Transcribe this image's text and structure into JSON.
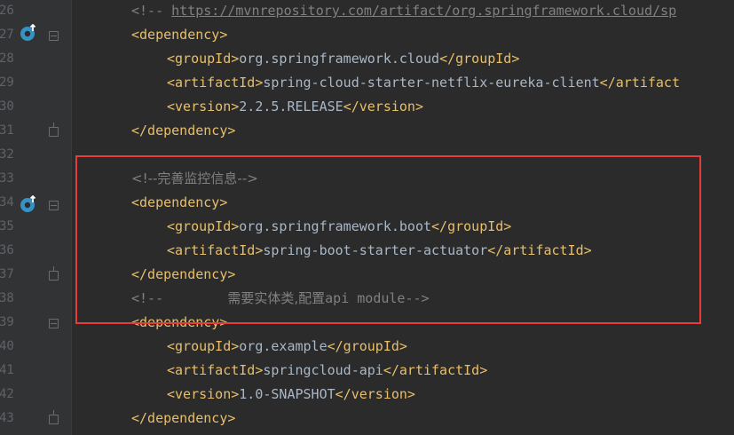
{
  "editor": {
    "line_numbers": [
      "26",
      "27",
      "28",
      "29",
      "30",
      "31",
      "32",
      "33",
      "34",
      "35",
      "36",
      "37",
      "38",
      "39",
      "40",
      "41",
      "42",
      "43"
    ],
    "lines": [
      {
        "comment_open": "<!-- ",
        "link": "https://mvnrepository.com/artifact/org.springframework.cloud/sp"
      },
      {
        "tag": "<dependency>"
      },
      {
        "open": "<groupId>",
        "value": "org.springframework.cloud",
        "close": "</groupId>"
      },
      {
        "open": "<artifactId>",
        "value": "spring-cloud-starter-netflix-eureka-client",
        "close": "</artifact"
      },
      {
        "open": "<version>",
        "value": "2.2.5.RELEASE",
        "close": "</version>"
      },
      {
        "tag": "</dependency>"
      },
      {},
      {
        "comment": "<!--完善监控信息-->"
      },
      {
        "tag": "<dependency>"
      },
      {
        "open": "<groupId>",
        "value": "org.springframework.boot",
        "close": "</groupId>"
      },
      {
        "open": "<artifactId>",
        "value": "spring-boot-starter-actuator",
        "close": "</artifactId>"
      },
      {
        "tag": "</dependency>"
      },
      {
        "comment_a": "<!--        ",
        "comment_b": "需要实体类,配置",
        "comment_c": "api module-->"
      },
      {
        "tag": "<dependency>"
      },
      {
        "open": "<groupId>",
        "value": "org.example",
        "close": "</groupId>"
      },
      {
        "open": "<artifactId>",
        "value": "springcloud-api",
        "close": "</artifactId>"
      },
      {
        "open": "<version>",
        "value": "1.0-SNAPSHOT",
        "close": "</version>"
      },
      {
        "tag": "</dependency>"
      }
    ]
  },
  "colors": {
    "background": "#2b2b2b",
    "gutter": "#313335",
    "tag": "#e8bf6a",
    "text": "#a9b7c6",
    "comment": "#808080",
    "highlight_border": "#e83b3b"
  }
}
